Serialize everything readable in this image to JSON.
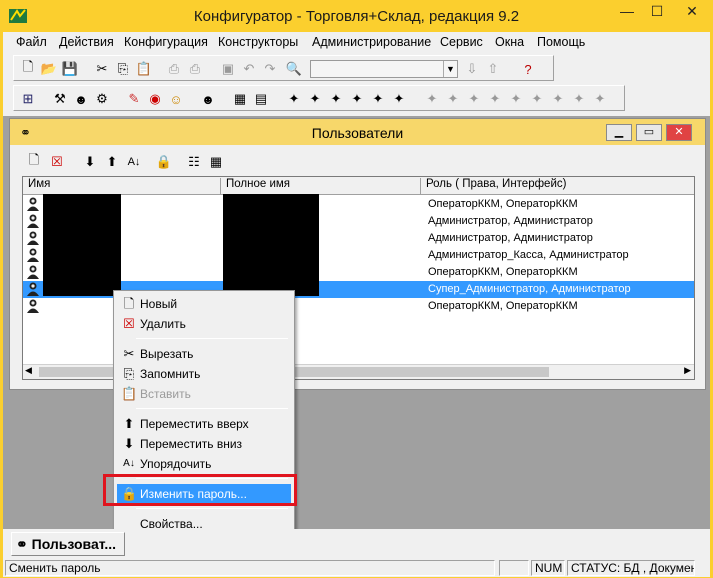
{
  "window": {
    "title": "Конфигуратор - Торговля+Склад, редакция 9.2",
    "minimize": "—",
    "maximize": "☐",
    "close": "✕"
  },
  "menu": [
    "Файл",
    "Действия",
    "Конфигурация",
    "Конструкторы",
    "Администрирование",
    "Сервис",
    "Окна",
    "Помощь"
  ],
  "child": {
    "title": "Пользователи"
  },
  "grid": {
    "columns": [
      "Имя",
      "Полное имя",
      "Роль ( Права, Интерфейс)"
    ],
    "rows": [
      {
        "role": "ОператорККМ, ОператорККМ"
      },
      {
        "role": "Администратор, Администратор"
      },
      {
        "role": "Администратор, Администратор"
      },
      {
        "role": "Администратор_Касса, Администратор"
      },
      {
        "role": "ОператорККМ, ОператорККМ"
      },
      {
        "role": "Супер_Администратор, Администратор",
        "selected": true
      },
      {
        "role": "ОператорККМ, ОператорККМ"
      }
    ]
  },
  "context_menu": [
    {
      "label": "Новый",
      "icon": "new-icon"
    },
    {
      "label": "Удалить",
      "icon": "delete-icon"
    },
    {
      "sep": true
    },
    {
      "label": "Вырезать",
      "icon": "cut-icon"
    },
    {
      "label": "Запомнить",
      "icon": "copy-icon"
    },
    {
      "label": "Вставить",
      "icon": "paste-icon",
      "disabled": true
    },
    {
      "sep": true
    },
    {
      "label": "Переместить вверх",
      "icon": "arrow-up-icon"
    },
    {
      "label": "Переместить вниз",
      "icon": "arrow-down-icon"
    },
    {
      "label": "Упорядочить",
      "icon": "sort-icon"
    },
    {
      "sep": true
    },
    {
      "label": "Изменить пароль...",
      "icon": "lock-icon",
      "highlighted": true
    },
    {
      "sep": true
    },
    {
      "label": "Свойства...",
      "icon": ""
    }
  ],
  "tab": {
    "label": "Пользоват..."
  },
  "status": {
    "hint": "Сменить пароль",
    "num": "NUM",
    "info": "СТАТУС: БД , Докумен"
  },
  "colors": {
    "accent": "#3399ff",
    "title_bg": "#fbcf2e",
    "highlight_box": "#e0141e"
  }
}
